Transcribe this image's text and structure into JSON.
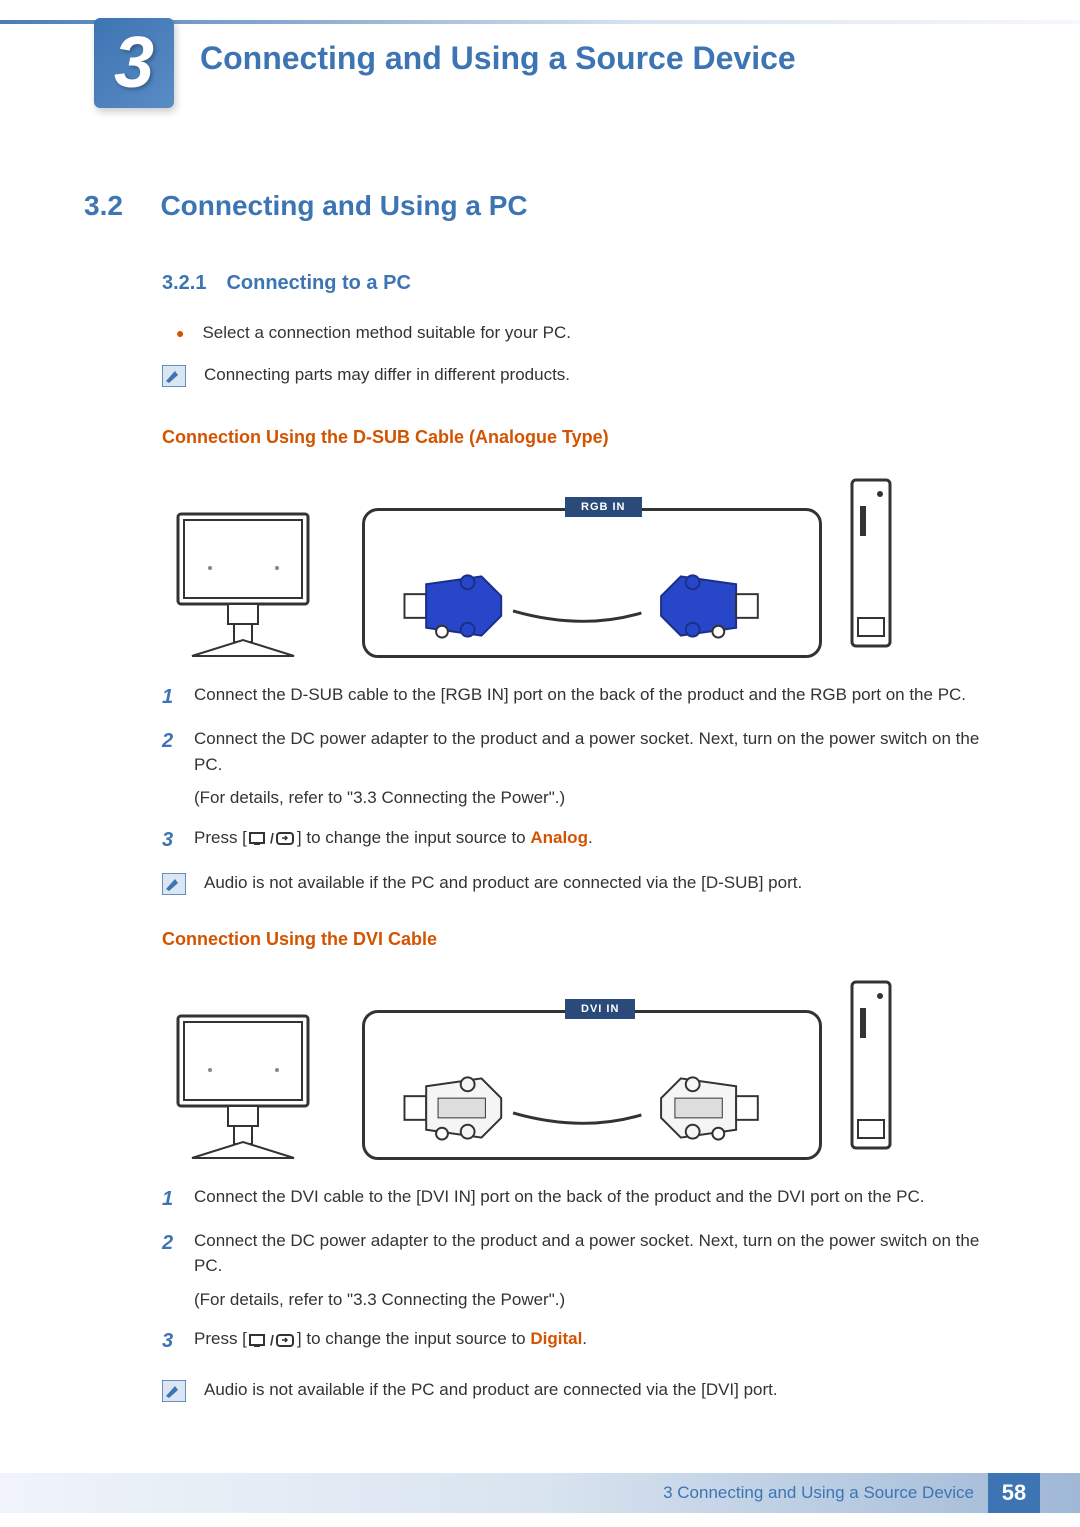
{
  "chapter": {
    "number": "3",
    "title": "Connecting and Using a Source Device"
  },
  "section": {
    "number": "3.2",
    "title": "Connecting and Using a PC"
  },
  "subsection": {
    "number": "3.2.1",
    "title": "Connecting to a PC"
  },
  "bullet1": "Select a connection method suitable for your PC.",
  "note1": "Connecting parts may differ in different products.",
  "dsub": {
    "heading": "Connection Using the D-SUB Cable (Analogue Type)",
    "port_label": "RGB IN",
    "steps": {
      "s1": "Connect the D-SUB cable to the [RGB IN] port on the back of the product and the RGB port on the PC.",
      "s2": "Connect the DC power adapter to the product and a power socket. Next, turn on the power switch on the PC.",
      "s2_ref": "(For details, refer to \"3.3 Connecting the Power\".)",
      "s3_a": "Press [",
      "s3_b": "] to change the input source to ",
      "s3_hl": "Analog",
      "s3_c": "."
    },
    "note": "Audio is not available if the PC and product are connected via the [D-SUB] port."
  },
  "dvi": {
    "heading": "Connection Using the DVI Cable",
    "port_label": "DVI IN",
    "steps": {
      "s1": "Connect the DVI cable to the [DVI IN] port on the back of the product and the DVI port on the PC.",
      "s2": "Connect the DC power adapter to the product and a power socket. Next, turn on the power switch on the PC.",
      "s2_ref": "(For details, refer to \"3.3 Connecting the Power\".)",
      "s3_a": "Press [",
      "s3_b": "] to change the input source to ",
      "s3_hl": "Digital",
      "s3_c": "."
    },
    "note": "Audio is not available if the PC and product are connected via the [DVI] port."
  },
  "footer": {
    "chapter_label": "3 Connecting and Using a Source Device",
    "page": "58"
  }
}
